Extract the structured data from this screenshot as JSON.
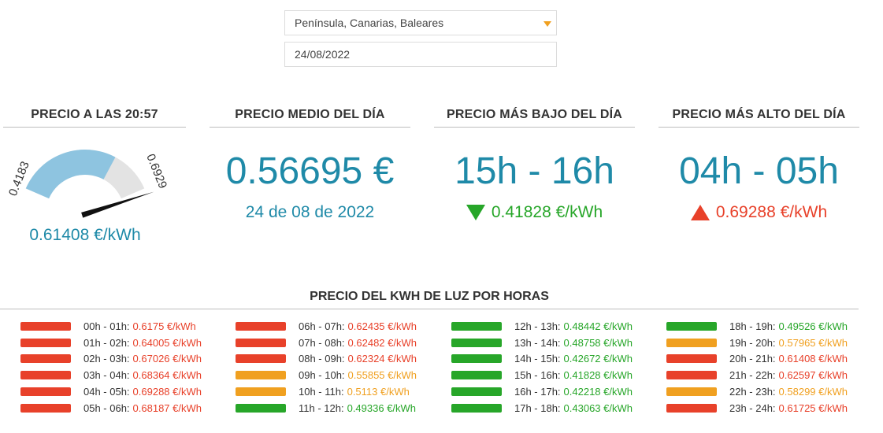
{
  "region_select": {
    "value": "Península, Canarias, Baleares"
  },
  "date_input": {
    "value": "24/08/2022"
  },
  "colors": {
    "accent": "#1f8aa8",
    "low": "#27a629",
    "mid": "#f0a020",
    "high": "#e8412a",
    "gauge_fill": "#8ec4e0",
    "gauge_bg": "#e3e3e3"
  },
  "now_card": {
    "title": "PRECIO A LAS 20:57",
    "gauge_min": "0.4183",
    "gauge_max": "0.6929",
    "value": "0.61408 €/kWh",
    "level": 0.71,
    "needle": 0.9
  },
  "avg_card": {
    "title": "PRECIO MEDIO DEL DÍA",
    "value": "0.56695 €",
    "date": "24 de 08 de 2022"
  },
  "low_card": {
    "title": "PRECIO MÁS BAJO DEL DÍA",
    "range": "15h - 16h",
    "price": "0.41828 €/kWh"
  },
  "high_card": {
    "title": "PRECIO MÁS ALTO DEL DÍA",
    "range": "04h - 05h",
    "price": "0.69288 €/kWh"
  },
  "hours": {
    "title": "PRECIO DEL KWH DE LUZ POR HORAS",
    "columns": [
      [
        {
          "label": "00h - 01h:",
          "value": "0.6175 €/kWh",
          "level": "high"
        },
        {
          "label": "01h - 02h:",
          "value": "0.64005 €/kWh",
          "level": "high"
        },
        {
          "label": "02h - 03h:",
          "value": "0.67026 €/kWh",
          "level": "high"
        },
        {
          "label": "03h - 04h:",
          "value": "0.68364 €/kWh",
          "level": "high"
        },
        {
          "label": "04h - 05h:",
          "value": "0.69288 €/kWh",
          "level": "high"
        },
        {
          "label": "05h - 06h:",
          "value": "0.68187 €/kWh",
          "level": "high"
        }
      ],
      [
        {
          "label": "06h - 07h:",
          "value": "0.62435 €/kWh",
          "level": "high"
        },
        {
          "label": "07h - 08h:",
          "value": "0.62482 €/kWh",
          "level": "high"
        },
        {
          "label": "08h - 09h:",
          "value": "0.62324 €/kWh",
          "level": "high"
        },
        {
          "label": "09h - 10h:",
          "value": "0.55855 €/kWh",
          "level": "mid"
        },
        {
          "label": "10h - 11h:",
          "value": "0.5113 €/kWh",
          "level": "mid"
        },
        {
          "label": "11h - 12h:",
          "value": "0.49336 €/kWh",
          "level": "low"
        }
      ],
      [
        {
          "label": "12h - 13h:",
          "value": "0.48442 €/kWh",
          "level": "low"
        },
        {
          "label": "13h - 14h:",
          "value": "0.48758 €/kWh",
          "level": "low"
        },
        {
          "label": "14h - 15h:",
          "value": "0.42672 €/kWh",
          "level": "low"
        },
        {
          "label": "15h - 16h:",
          "value": "0.41828 €/kWh",
          "level": "low"
        },
        {
          "label": "16h - 17h:",
          "value": "0.42218 €/kWh",
          "level": "low"
        },
        {
          "label": "17h - 18h:",
          "value": "0.43063 €/kWh",
          "level": "low"
        }
      ],
      [
        {
          "label": "18h - 19h:",
          "value": "0.49526 €/kWh",
          "level": "low"
        },
        {
          "label": "19h - 20h:",
          "value": "0.57965 €/kWh",
          "level": "mid"
        },
        {
          "label": "20h - 21h:",
          "value": "0.61408 €/kWh",
          "level": "high"
        },
        {
          "label": "21h - 22h:",
          "value": "0.62597 €/kWh",
          "level": "high"
        },
        {
          "label": "22h - 23h:",
          "value": "0.58299 €/kWh",
          "level": "mid"
        },
        {
          "label": "23h - 24h:",
          "value": "0.61725 €/kWh",
          "level": "high"
        }
      ]
    ]
  }
}
